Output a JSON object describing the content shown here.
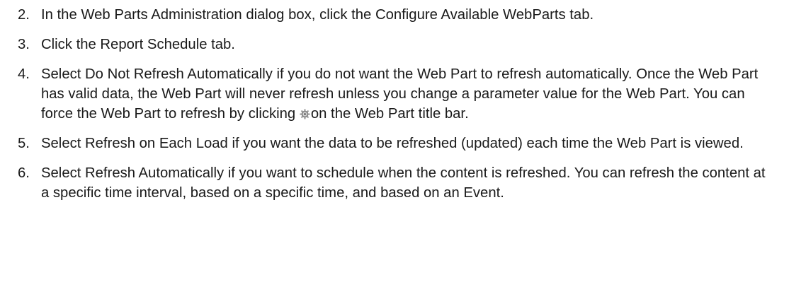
{
  "steps": [
    {
      "number": "2.",
      "text": "In the Web Parts Administration dialog box, click the Configure Available WebParts tab."
    },
    {
      "number": "3.",
      "text": "Click the Report Schedule tab."
    },
    {
      "number": "4.",
      "text_before_icon": "Select Do Not Refresh Automatically if you do not want the Web Part to refresh automatically. Once the Web Part has valid data, the Web Part will never refresh unless you change a parameter value for the Web Part. You can force the Web Part to refresh by clicking ",
      "icon": "refresh-gear-icon",
      "text_after_icon": "on the Web Part title bar."
    },
    {
      "number": "5.",
      "text": "Select Refresh on Each Load if you want the data to be refreshed (updated) each time the Web Part is viewed."
    },
    {
      "number": "6.",
      "text": "Select Refresh Automatically if you want to schedule when the content is refreshed. You can refresh the content at a specific time interval, based on a specific time, and based on an Event."
    }
  ]
}
